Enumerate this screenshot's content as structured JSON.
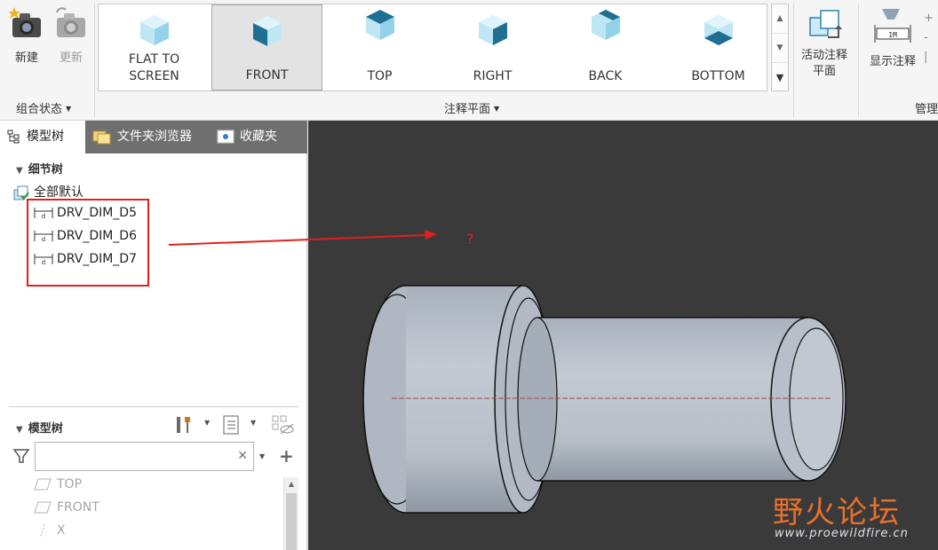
{
  "ribbon": {
    "new_label": "新建",
    "update_label": "更新",
    "combo_state_label": "组合状态",
    "annotation_plane_label": "注释平面",
    "active_plane_label_1": "活动注释",
    "active_plane_label_2": "平面",
    "show_annotation_label": "显示注释",
    "manage_label": "管理",
    "gallery": [
      {
        "line1": "FLAT TO",
        "line2": "SCREEN"
      },
      {
        "line1": "FRONT"
      },
      {
        "line1": "TOP"
      },
      {
        "line1": "RIGHT"
      },
      {
        "line1": "BACK"
      },
      {
        "line1": "BOTTOM"
      }
    ]
  },
  "panel": {
    "tabs": [
      "模型树",
      "文件夹浏览器",
      "收藏夹"
    ],
    "detail_tree_title": "细节树",
    "root_item": "全部默认",
    "dims": [
      "DRV_DIM_D5",
      "DRV_DIM_D6",
      "DRV_DIM_D7"
    ],
    "model_tree_title": "模型树",
    "model_items": [
      "TOP",
      "FRONT",
      "X"
    ]
  },
  "viewport": {
    "question_mark": "?"
  },
  "watermark": {
    "cn": "野火论坛",
    "url": "www.proewildfire.cn"
  },
  "colors": {
    "annotation_red": "#e02020",
    "viewport_bg": "#3a3a3a",
    "part_metal": "#b9c0cb",
    "watermark_orange": "#e8702a"
  }
}
